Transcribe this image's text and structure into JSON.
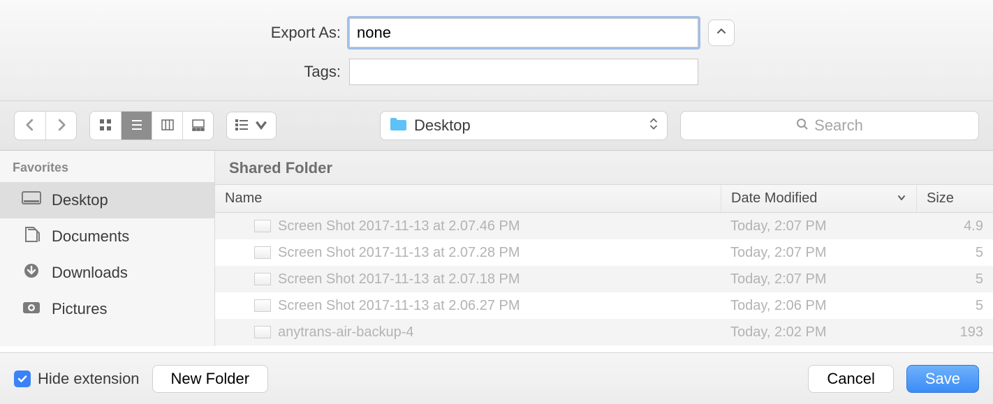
{
  "form": {
    "export_as_label": "Export As:",
    "filename_value": "none",
    "tags_label": "Tags:",
    "tags_value": ""
  },
  "toolbar": {
    "location": "Desktop",
    "search_placeholder": "Search"
  },
  "sidebar": {
    "heading": "Favorites",
    "items": [
      {
        "label": "Desktop",
        "selected": true
      },
      {
        "label": "Documents",
        "selected": false
      },
      {
        "label": "Downloads",
        "selected": false
      },
      {
        "label": "Pictures",
        "selected": false
      }
    ]
  },
  "panel": {
    "title": "Shared Folder",
    "columns": {
      "name": "Name",
      "date": "Date Modified",
      "size": "Size"
    },
    "rows": [
      {
        "name": "Screen Shot 2017-11-13 at 2.07.46 PM",
        "date": "Today, 2:07 PM",
        "size": "4.9"
      },
      {
        "name": "Screen Shot 2017-11-13 at 2.07.28 PM",
        "date": "Today, 2:07 PM",
        "size": "5"
      },
      {
        "name": "Screen Shot 2017-11-13 at 2.07.18 PM",
        "date": "Today, 2:07 PM",
        "size": "5"
      },
      {
        "name": "Screen Shot 2017-11-13 at 2.06.27 PM",
        "date": "Today, 2:06 PM",
        "size": "5"
      },
      {
        "name": "anytrans-air-backup-4",
        "date": "Today, 2:02 PM",
        "size": "193"
      }
    ]
  },
  "bottom": {
    "hide_extension_label": "Hide extension",
    "new_folder_label": "New Folder",
    "cancel_label": "Cancel",
    "save_label": "Save"
  }
}
